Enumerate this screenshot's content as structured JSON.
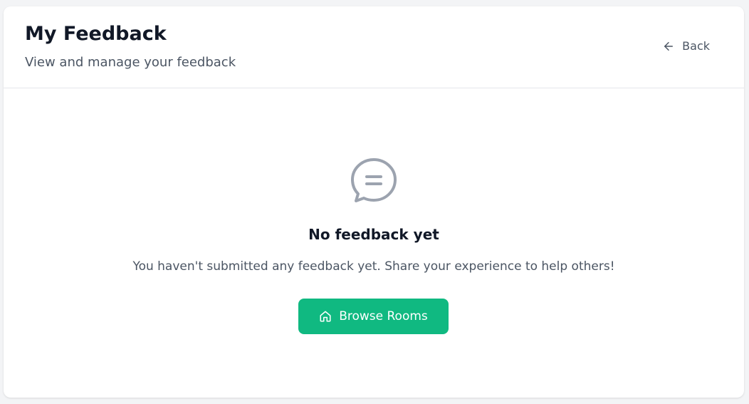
{
  "header": {
    "title": "My Feedback",
    "subtitle": "View and manage your feedback",
    "back_label": "Back"
  },
  "empty_state": {
    "icon": "chat-bubble-icon",
    "title": "No feedback yet",
    "message": "You haven't submitted any feedback yet. Share your experience to help others!",
    "button_label": "Browse Rooms",
    "button_icon": "home-icon"
  },
  "colors": {
    "accent": "#10b981",
    "title_text": "#111827",
    "body_text": "#4b5563",
    "icon_gray": "#9ca3af",
    "page_background": "#f3f4f6",
    "card_background": "#ffffff",
    "divider": "#e5e7eb"
  }
}
